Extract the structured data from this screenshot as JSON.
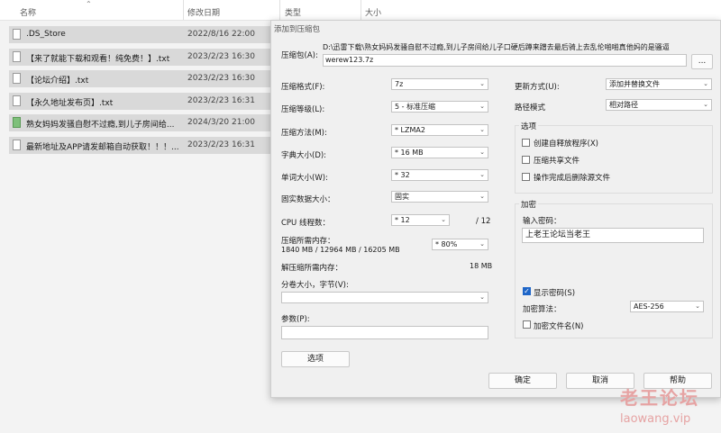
{
  "explorer": {
    "columns": [
      "名称",
      "修改日期",
      "类型",
      "大小"
    ],
    "files": [
      {
        "name": ".DS_Store",
        "date": "2022/8/16 22:00",
        "icon": "file-icon"
      },
      {
        "name": "【来了就能下载和观看！纯免费！】.txt",
        "date": "2023/2/23 16:30",
        "icon": "file-icon"
      },
      {
        "name": "【论坛介绍】.txt",
        "date": "2023/2/23 16:30",
        "icon": "file-icon"
      },
      {
        "name": "【永久地址发布页】.txt",
        "date": "2023/2/23 16:31",
        "icon": "file-icon"
      },
      {
        "name": "熟女妈妈发骚自慰不过瘾,到儿子房间给...",
        "date": "2024/3/20 21:00",
        "icon": "image-file-icon"
      },
      {
        "name": "最新地址及APP请发邮箱自动获取！！！...",
        "date": "2023/2/23 16:31",
        "icon": "file-icon"
      }
    ]
  },
  "dialog": {
    "title": "添加到压缩包",
    "archive_label": "压缩包(A):",
    "archive_path": "D:\\迅雷下载\\熟女妈妈发骚自慰不过瘾,到儿子房间给儿子口硬后蹲来蹭去最后骑上去乱伦啪啪真他妈的是骚逼",
    "archive_name": "werew123.7z",
    "browse_label": "...",
    "format_label": "压缩格式(F):",
    "format_value": "7z",
    "level_label": "压缩等级(L):",
    "level_value": "5 - 标准压缩",
    "method_label": "压缩方法(M):",
    "method_value": "* LZMA2",
    "dict_label": "字典大小(D):",
    "dict_value": "* 16 MB",
    "word_label": "单词大小(W):",
    "word_value": "* 32",
    "solid_label": "固实数据大小：",
    "solid_value": "固实",
    "cpu_label": "CPU 线程数：",
    "cpu_value": "* 12",
    "cpu_max": "/ 12",
    "mem_label": "压缩所需内存：",
    "mem_detail": "1840 MB / 12964 MB / 16205 MB",
    "mem_percent": "* 80%",
    "decomp_label": "解压缩所需内存：",
    "decomp_value": "18 MB",
    "split_label": "分卷大小，字节(V):",
    "split_value": "",
    "params_label": "参数(P):",
    "params_value": "",
    "options_button": "选项",
    "update_label": "更新方式(U):",
    "update_value": "添加并替换文件",
    "pathmode_label": "路径模式",
    "pathmode_value": "相对路径",
    "options_group": "选项",
    "opt_sfx": "创建自释放程序(X)",
    "opt_shared": "压缩共享文件",
    "opt_delete": "操作完成后删除源文件",
    "encrypt_group": "加密",
    "pwd_label": "输入密码：",
    "pwd_value": "上老王论坛当老王",
    "show_pwd": "显示密码(S)",
    "enc_method_label": "加密算法：",
    "enc_method_value": "AES-256",
    "enc_names": "加密文件名(N)",
    "ok": "确定",
    "cancel": "取消",
    "help": "帮助"
  },
  "watermark": {
    "line1": "老王论坛",
    "line2": "laowang.vip"
  },
  "colors": {
    "selection": "#d9d9d9",
    "checkbox_on": "#1f66c8",
    "watermark": "#e6a3a3"
  }
}
